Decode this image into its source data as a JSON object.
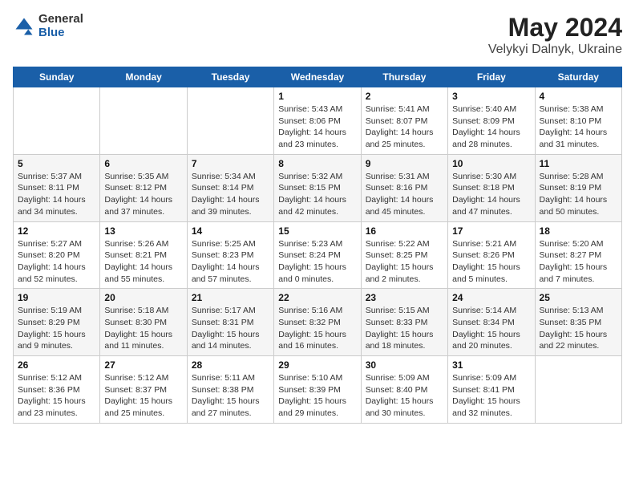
{
  "header": {
    "logo_general": "General",
    "logo_blue": "Blue",
    "title": "May 2024",
    "location": "Velykyi Dalnyk, Ukraine"
  },
  "weekdays": [
    "Sunday",
    "Monday",
    "Tuesday",
    "Wednesday",
    "Thursday",
    "Friday",
    "Saturday"
  ],
  "weeks": [
    [
      {
        "day": "",
        "sunrise": "",
        "sunset": "",
        "daylight": ""
      },
      {
        "day": "",
        "sunrise": "",
        "sunset": "",
        "daylight": ""
      },
      {
        "day": "",
        "sunrise": "",
        "sunset": "",
        "daylight": ""
      },
      {
        "day": "1",
        "sunrise": "Sunrise: 5:43 AM",
        "sunset": "Sunset: 8:06 PM",
        "daylight": "Daylight: 14 hours and 23 minutes."
      },
      {
        "day": "2",
        "sunrise": "Sunrise: 5:41 AM",
        "sunset": "Sunset: 8:07 PM",
        "daylight": "Daylight: 14 hours and 25 minutes."
      },
      {
        "day": "3",
        "sunrise": "Sunrise: 5:40 AM",
        "sunset": "Sunset: 8:09 PM",
        "daylight": "Daylight: 14 hours and 28 minutes."
      },
      {
        "day": "4",
        "sunrise": "Sunrise: 5:38 AM",
        "sunset": "Sunset: 8:10 PM",
        "daylight": "Daylight: 14 hours and 31 minutes."
      }
    ],
    [
      {
        "day": "5",
        "sunrise": "Sunrise: 5:37 AM",
        "sunset": "Sunset: 8:11 PM",
        "daylight": "Daylight: 14 hours and 34 minutes."
      },
      {
        "day": "6",
        "sunrise": "Sunrise: 5:35 AM",
        "sunset": "Sunset: 8:12 PM",
        "daylight": "Daylight: 14 hours and 37 minutes."
      },
      {
        "day": "7",
        "sunrise": "Sunrise: 5:34 AM",
        "sunset": "Sunset: 8:14 PM",
        "daylight": "Daylight: 14 hours and 39 minutes."
      },
      {
        "day": "8",
        "sunrise": "Sunrise: 5:32 AM",
        "sunset": "Sunset: 8:15 PM",
        "daylight": "Daylight: 14 hours and 42 minutes."
      },
      {
        "day": "9",
        "sunrise": "Sunrise: 5:31 AM",
        "sunset": "Sunset: 8:16 PM",
        "daylight": "Daylight: 14 hours and 45 minutes."
      },
      {
        "day": "10",
        "sunrise": "Sunrise: 5:30 AM",
        "sunset": "Sunset: 8:18 PM",
        "daylight": "Daylight: 14 hours and 47 minutes."
      },
      {
        "day": "11",
        "sunrise": "Sunrise: 5:28 AM",
        "sunset": "Sunset: 8:19 PM",
        "daylight": "Daylight: 14 hours and 50 minutes."
      }
    ],
    [
      {
        "day": "12",
        "sunrise": "Sunrise: 5:27 AM",
        "sunset": "Sunset: 8:20 PM",
        "daylight": "Daylight: 14 hours and 52 minutes."
      },
      {
        "day": "13",
        "sunrise": "Sunrise: 5:26 AM",
        "sunset": "Sunset: 8:21 PM",
        "daylight": "Daylight: 14 hours and 55 minutes."
      },
      {
        "day": "14",
        "sunrise": "Sunrise: 5:25 AM",
        "sunset": "Sunset: 8:23 PM",
        "daylight": "Daylight: 14 hours and 57 minutes."
      },
      {
        "day": "15",
        "sunrise": "Sunrise: 5:23 AM",
        "sunset": "Sunset: 8:24 PM",
        "daylight": "Daylight: 15 hours and 0 minutes."
      },
      {
        "day": "16",
        "sunrise": "Sunrise: 5:22 AM",
        "sunset": "Sunset: 8:25 PM",
        "daylight": "Daylight: 15 hours and 2 minutes."
      },
      {
        "day": "17",
        "sunrise": "Sunrise: 5:21 AM",
        "sunset": "Sunset: 8:26 PM",
        "daylight": "Daylight: 15 hours and 5 minutes."
      },
      {
        "day": "18",
        "sunrise": "Sunrise: 5:20 AM",
        "sunset": "Sunset: 8:27 PM",
        "daylight": "Daylight: 15 hours and 7 minutes."
      }
    ],
    [
      {
        "day": "19",
        "sunrise": "Sunrise: 5:19 AM",
        "sunset": "Sunset: 8:29 PM",
        "daylight": "Daylight: 15 hours and 9 minutes."
      },
      {
        "day": "20",
        "sunrise": "Sunrise: 5:18 AM",
        "sunset": "Sunset: 8:30 PM",
        "daylight": "Daylight: 15 hours and 11 minutes."
      },
      {
        "day": "21",
        "sunrise": "Sunrise: 5:17 AM",
        "sunset": "Sunset: 8:31 PM",
        "daylight": "Daylight: 15 hours and 14 minutes."
      },
      {
        "day": "22",
        "sunrise": "Sunrise: 5:16 AM",
        "sunset": "Sunset: 8:32 PM",
        "daylight": "Daylight: 15 hours and 16 minutes."
      },
      {
        "day": "23",
        "sunrise": "Sunrise: 5:15 AM",
        "sunset": "Sunset: 8:33 PM",
        "daylight": "Daylight: 15 hours and 18 minutes."
      },
      {
        "day": "24",
        "sunrise": "Sunrise: 5:14 AM",
        "sunset": "Sunset: 8:34 PM",
        "daylight": "Daylight: 15 hours and 20 minutes."
      },
      {
        "day": "25",
        "sunrise": "Sunrise: 5:13 AM",
        "sunset": "Sunset: 8:35 PM",
        "daylight": "Daylight: 15 hours and 22 minutes."
      }
    ],
    [
      {
        "day": "26",
        "sunrise": "Sunrise: 5:12 AM",
        "sunset": "Sunset: 8:36 PM",
        "daylight": "Daylight: 15 hours and 23 minutes."
      },
      {
        "day": "27",
        "sunrise": "Sunrise: 5:12 AM",
        "sunset": "Sunset: 8:37 PM",
        "daylight": "Daylight: 15 hours and 25 minutes."
      },
      {
        "day": "28",
        "sunrise": "Sunrise: 5:11 AM",
        "sunset": "Sunset: 8:38 PM",
        "daylight": "Daylight: 15 hours and 27 minutes."
      },
      {
        "day": "29",
        "sunrise": "Sunrise: 5:10 AM",
        "sunset": "Sunset: 8:39 PM",
        "daylight": "Daylight: 15 hours and 29 minutes."
      },
      {
        "day": "30",
        "sunrise": "Sunrise: 5:09 AM",
        "sunset": "Sunset: 8:40 PM",
        "daylight": "Daylight: 15 hours and 30 minutes."
      },
      {
        "day": "31",
        "sunrise": "Sunrise: 5:09 AM",
        "sunset": "Sunset: 8:41 PM",
        "daylight": "Daylight: 15 hours and 32 minutes."
      },
      {
        "day": "",
        "sunrise": "",
        "sunset": "",
        "daylight": ""
      }
    ]
  ]
}
